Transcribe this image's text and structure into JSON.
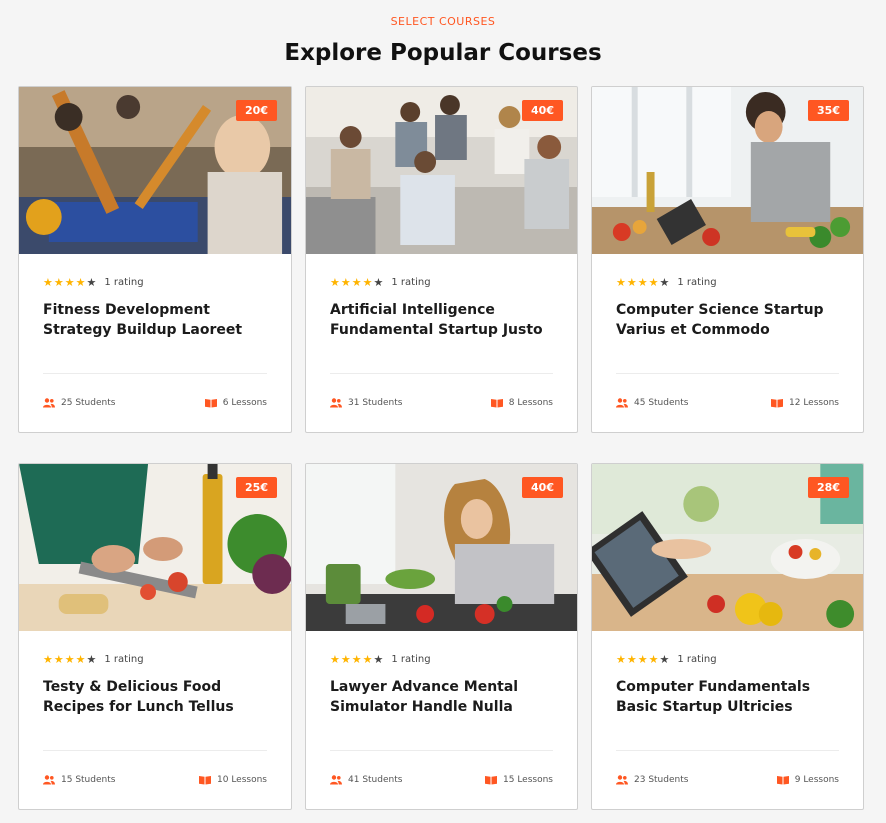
{
  "header": {
    "subtitle": "SELECT COURSES",
    "title": "Explore Popular Courses"
  },
  "colors": {
    "accent": "#ff5722",
    "star": "#ffb400"
  },
  "icons": {
    "students": "users-icon",
    "lessons": "open-book-icon",
    "star": "star-icon"
  },
  "courses": [
    {
      "price": "20€",
      "stars": 4,
      "rating": "1 rating",
      "title": "Fitness Development Strategy Buildup Laoreet",
      "students": "25 Students",
      "lessons": "6 Lessons"
    },
    {
      "price": "40€",
      "stars": 4,
      "rating": "1 rating",
      "title": "Artificial Intelligence Fundamental Startup Justo",
      "students": "31 Students",
      "lessons": "8 Lessons"
    },
    {
      "price": "35€",
      "stars": 4,
      "rating": "1 rating",
      "title": "Computer Science Startup Varius et Commodo",
      "students": "45 Students",
      "lessons": "12 Lessons"
    },
    {
      "price": "25€",
      "stars": 4,
      "rating": "1 rating",
      "title": "Testy & Delicious Food Recipes for Lunch Tellus",
      "students": "15 Students",
      "lessons": "10 Lessons"
    },
    {
      "price": "40€",
      "stars": 4,
      "rating": "1 rating",
      "title": "Lawyer Advance Mental Simulator Handle Nulla",
      "students": "41 Students",
      "lessons": "15 Lessons"
    },
    {
      "price": "28€",
      "stars": 4,
      "rating": "1 rating",
      "title": "Computer Fundamentals Basic Startup Ultricies",
      "students": "23 Students",
      "lessons": "9 Lessons"
    }
  ]
}
